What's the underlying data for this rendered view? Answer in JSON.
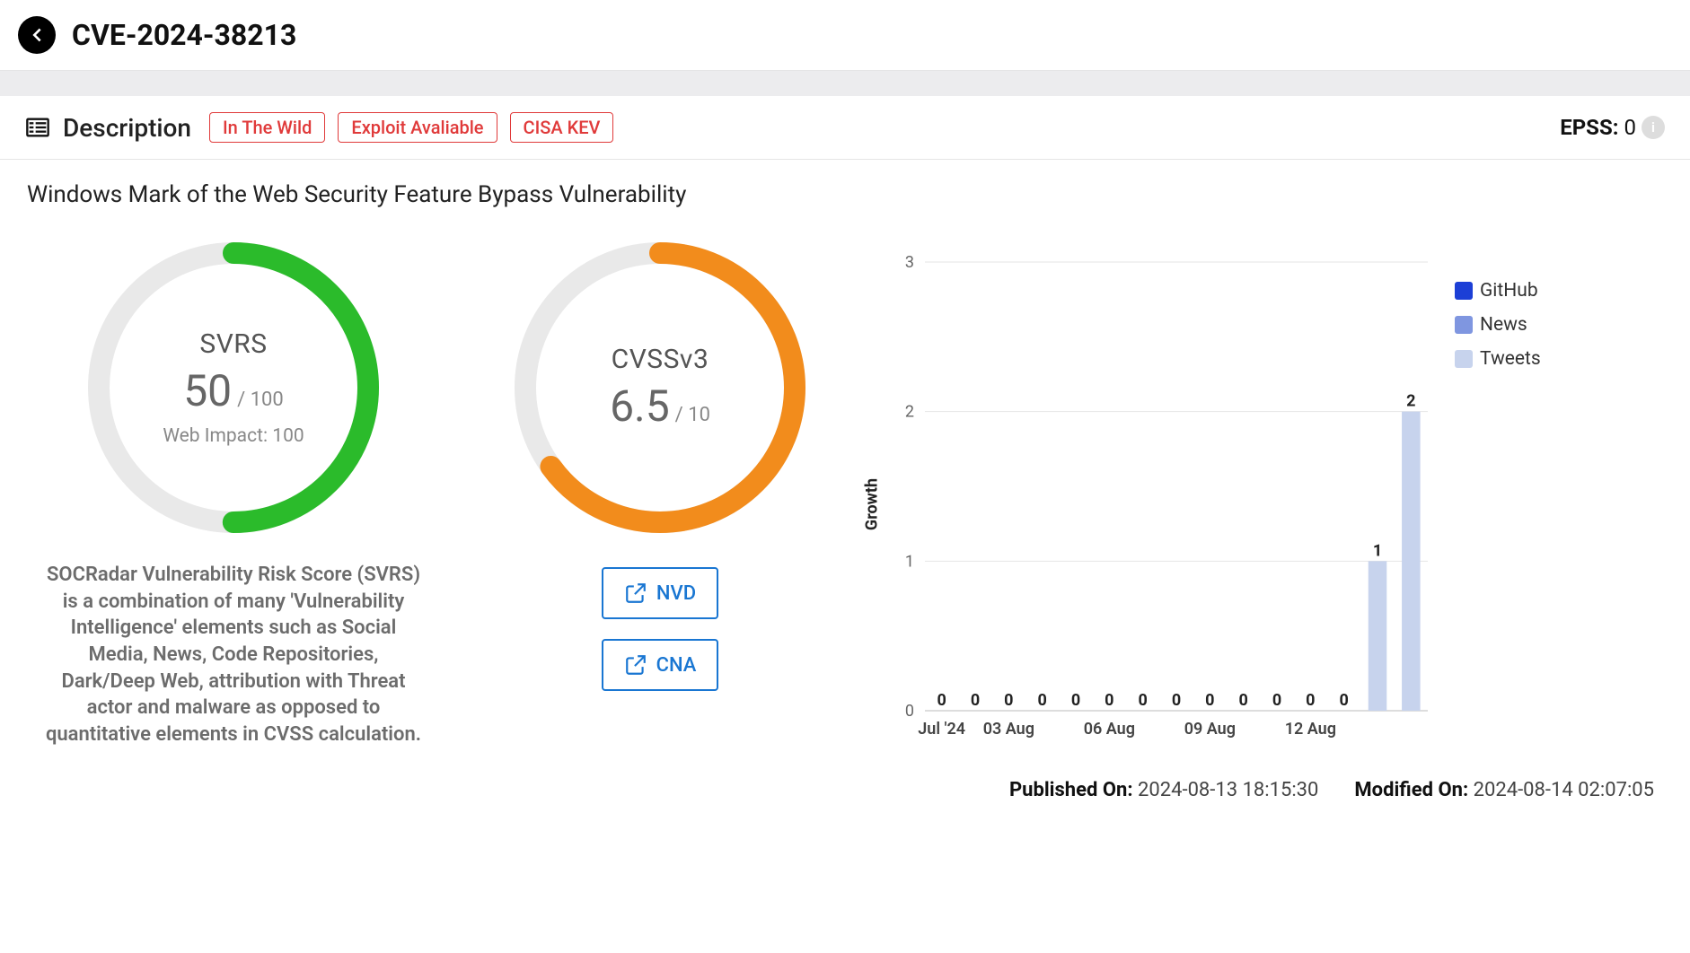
{
  "header": {
    "title": "CVE-2024-38213"
  },
  "description": {
    "section_label": "Description",
    "badges": [
      "In The Wild",
      "Exploit Avaliable",
      "CISA KEV"
    ],
    "text": "Windows Mark of the Web Security Feature Bypass Vulnerability",
    "epss_label": "EPSS:",
    "epss_value": "0"
  },
  "svrs": {
    "title": "SVRS",
    "value": "50",
    "max": "/ 100",
    "sub": "Web Impact: 100",
    "desc": "SOCRadar Vulnerability Risk Score (SVRS) is a combination of many 'Vulnerability Intelligence' elements such as Social Media, News, Code Repositories, Dark/Deep Web, attribution with Threat actor and malware as opposed to quantitative elements in CVSS calculation.",
    "color": "#2bbb2b",
    "percent": 50
  },
  "cvss": {
    "title": "CVSSv3",
    "value": "6.5",
    "max": "/ 10",
    "color": "#f28c1c",
    "percent": 65,
    "links": {
      "nvd": "NVD",
      "cna": "CNA"
    }
  },
  "chart_data": {
    "type": "bar",
    "title": "",
    "ylabel": "Growth",
    "ylim": [
      0,
      3
    ],
    "categories": [
      "Jul '24",
      "",
      "03 Aug",
      "",
      "",
      "06 Aug",
      "",
      "",
      "09 Aug",
      "",
      "",
      "12 Aug",
      "",
      "",
      ""
    ],
    "series": [
      {
        "name": "Tweets",
        "color": "#c7d3ed",
        "values": [
          0,
          0,
          0,
          0,
          0,
          0,
          0,
          0,
          0,
          0,
          0,
          0,
          0,
          1,
          2
        ]
      }
    ],
    "legend": [
      {
        "name": "GitHub",
        "color": "#1c3fd6"
      },
      {
        "name": "News",
        "color": "#7f96e0"
      },
      {
        "name": "Tweets",
        "color": "#c7d3ed"
      }
    ]
  },
  "footer": {
    "published_label": "Published On:",
    "published": "2024-08-13 18:15:30",
    "modified_label": "Modified On:",
    "modified": "2024-08-14 02:07:05"
  }
}
